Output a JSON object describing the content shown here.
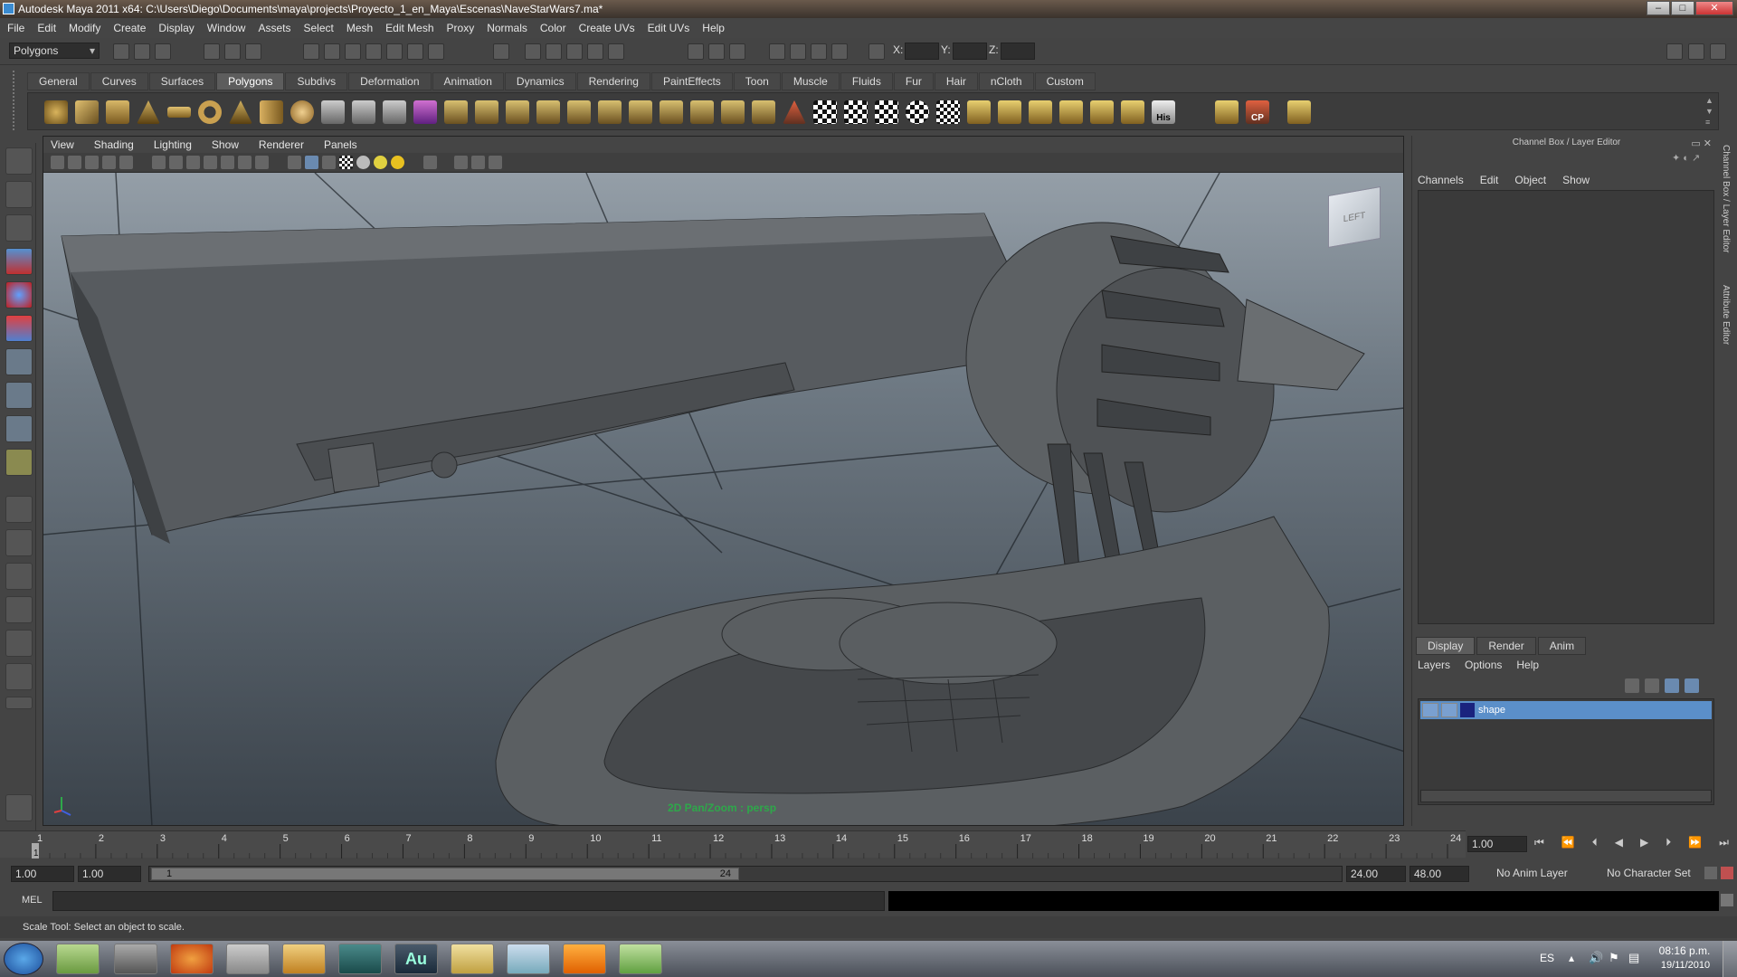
{
  "window": {
    "title": "Autodesk Maya 2011 x64: C:\\Users\\Diego\\Documents\\maya\\projects\\Proyecto_1_en_Maya\\Escenas\\NaveStarWars7.ma*"
  },
  "menubar": [
    "File",
    "Edit",
    "Modify",
    "Create",
    "Display",
    "Window",
    "Assets",
    "Select",
    "Mesh",
    "Edit Mesh",
    "Proxy",
    "Normals",
    "Color",
    "Create UVs",
    "Edit UVs",
    "Help"
  ],
  "statusline": {
    "mode": "Polygons",
    "x_label": "X:",
    "y_label": "Y:",
    "z_label": "Z:"
  },
  "shelf_tabs": [
    "General",
    "Curves",
    "Surfaces",
    "Polygons",
    "Subdivs",
    "Deformation",
    "Animation",
    "Dynamics",
    "Rendering",
    "PaintEffects",
    "Toon",
    "Muscle",
    "Fluids",
    "Fur",
    "Hair",
    "nCloth",
    "Custom"
  ],
  "shelf_active": "Polygons",
  "shelf_text_icons": [
    "His",
    "CP"
  ],
  "viewport": {
    "menu": [
      "View",
      "Shading",
      "Lighting",
      "Show",
      "Renderer",
      "Panels"
    ],
    "hud": "2D Pan/Zoom : persp",
    "view_cube_label": "LEFT"
  },
  "right_panel": {
    "title": "Channel Box / Layer Editor",
    "menu": [
      "Channels",
      "Edit",
      "Object",
      "Show"
    ],
    "layer_tabs": [
      "Display",
      "Render",
      "Anim"
    ],
    "layer_menu": [
      "Layers",
      "Options",
      "Help"
    ],
    "layer_name": "shape",
    "side_tabs": [
      "Channel Box / Layer Editor",
      "Attribute Editor"
    ]
  },
  "timeline": {
    "ticks": [
      "1",
      "2",
      "3",
      "4",
      "5",
      "6",
      "7",
      "8",
      "9",
      "10",
      "11",
      "12",
      "13",
      "14",
      "15",
      "16",
      "17",
      "18",
      "19",
      "20",
      "21",
      "22",
      "23",
      "24"
    ],
    "current_frame": "1.00",
    "current_marker": "1"
  },
  "range": {
    "start_time": "1.00",
    "start_range": "1.00",
    "slider_start": "1",
    "slider_end": "24",
    "end_range": "24.00",
    "end_time": "48.00",
    "anim_layer": "No Anim Layer",
    "char_set": "No Character Set"
  },
  "cmd": {
    "label": "MEL"
  },
  "helpline": "Scale Tool: Select an object to scale.",
  "taskbar": {
    "lang": "ES",
    "time": "08:16 p.m.",
    "date": "19/11/2010",
    "au_label": "Au"
  },
  "colors": {
    "layer_color": "#1a237e",
    "hud_green": "#2ea84a",
    "selected_row": "#5b8fc9"
  }
}
